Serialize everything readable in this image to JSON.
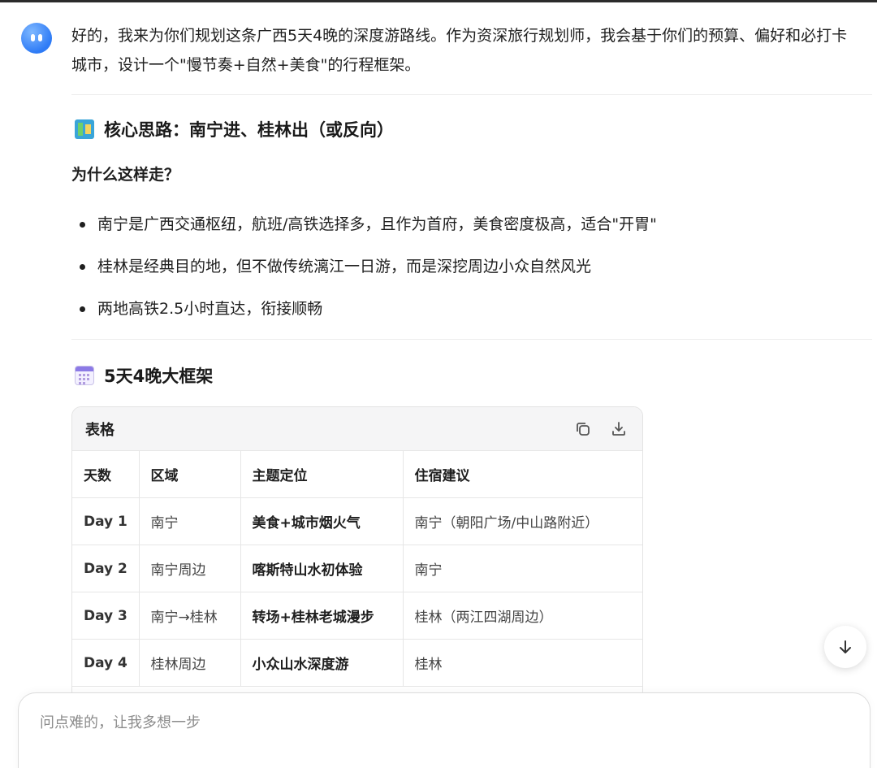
{
  "message": {
    "intro": "好的，我来为你们规划这条广西5天4晚的深度游路线。作为资深旅行规划师，我会基于你们的预算、偏好和必打卡城市，设计一个\"慢节奏+自然+美食\"的行程框架。",
    "section1": {
      "icon": "map-icon",
      "title": "核心思路：南宁进、桂林出（或反向）",
      "subheading": "为什么这样走？",
      "bullets": [
        "南宁是广西交通枢纽，航班/高铁选择多，且作为首府，美食密度极高，适合\"开胃\"",
        "桂林是经典目的地，但不做传统漓江一日游，而是深挖周边小众自然风光",
        "两地高铁2.5小时直达，衔接顺畅"
      ]
    },
    "section2": {
      "icon": "calendar-icon",
      "title": "5天4晚大框架"
    }
  },
  "table": {
    "label": "表格",
    "copy_icon": "copy-icon",
    "download_icon": "download-icon",
    "headers": [
      "天数",
      "区域",
      "主题定位",
      "住宿建议"
    ],
    "rows": [
      [
        "Day 1",
        "南宁",
        "美食+城市烟火气",
        "南宁（朝阳广场/中山路附近）"
      ],
      [
        "Day 2",
        "南宁周边",
        "喀斯特山水初体验",
        "南宁"
      ],
      [
        "Day 3",
        "南宁→桂林",
        "转场+桂林老城漫步",
        "桂林（两江四湖周边）"
      ],
      [
        "Day 4",
        "桂林周边",
        "小众山水深度游",
        "桂林"
      ]
    ]
  },
  "input": {
    "placeholder": "问点难的，让我多想一步"
  },
  "scroll_button_icon": "arrow-down-icon"
}
